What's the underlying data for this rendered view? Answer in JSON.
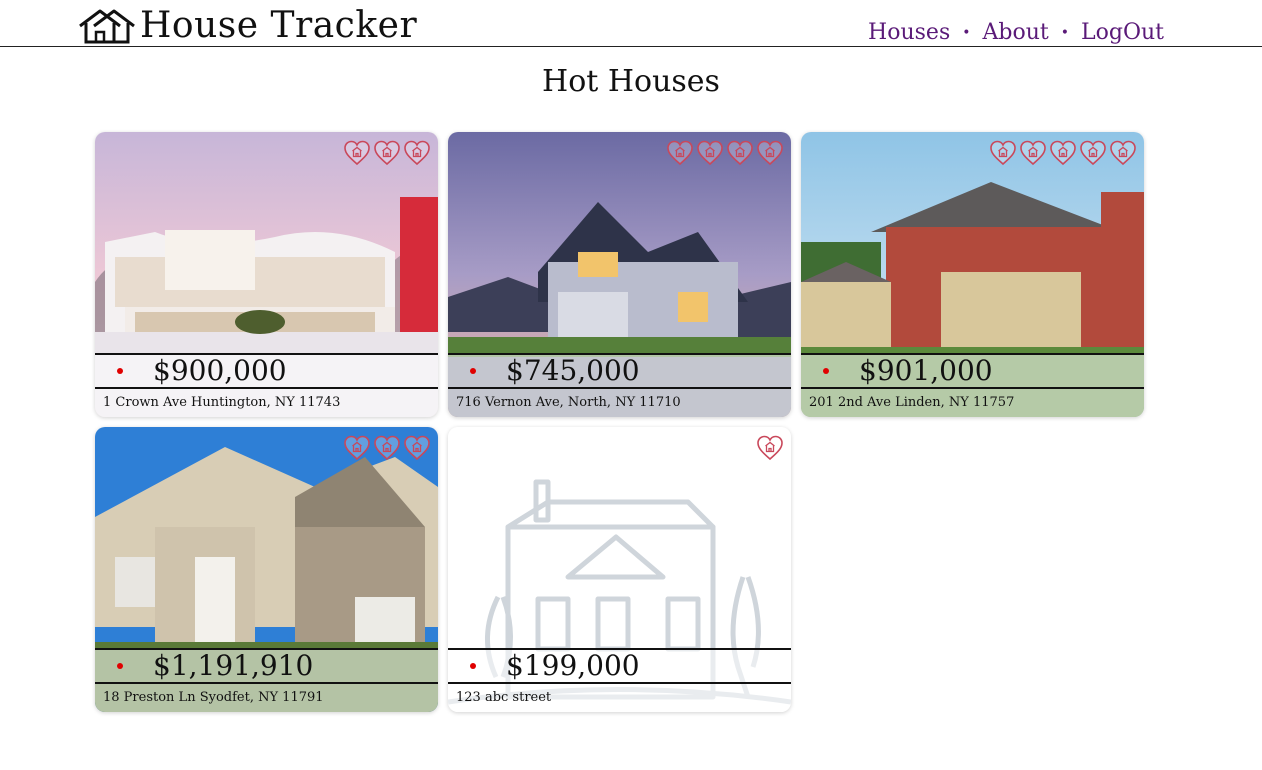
{
  "app": {
    "title": "House Tracker",
    "logo_icon": "house-outline-icon"
  },
  "nav": {
    "items": [
      {
        "label": "Houses"
      },
      {
        "label": "About"
      },
      {
        "label": "LogOut"
      }
    ],
    "separator": "•",
    "color": "#5a1a78"
  },
  "page": {
    "title": "Hot Houses"
  },
  "icons": {
    "favorite": "heart-house-icon",
    "bullet": "red-dot-icon"
  },
  "colors": {
    "accent": "#5a1a78",
    "heart": "#c9485b",
    "bullet": "#e00000"
  },
  "houses": [
    {
      "price": "$900,000",
      "address": "1 Crown Ave Huntington, NY 11743",
      "favorites": 3,
      "image": "modern-white-house"
    },
    {
      "price": "$745,000",
      "address": "716 Vernon Ave, North, NY 11710",
      "favorites": 4,
      "image": "craftsman-house-dusk"
    },
    {
      "price": "$901,000",
      "address": "201 2nd Ave Linden, NY 11757",
      "favorites": 5,
      "image": "brick-stone-house"
    },
    {
      "price": "$1,191,910",
      "address": "18 Preston Ln Syodfet, NY 11791",
      "favorites": 3,
      "image": "stone-colonial-house"
    },
    {
      "price": "$199,000",
      "address": "123 abc street",
      "favorites": 1,
      "image": "placeholder-house-sketch"
    }
  ]
}
